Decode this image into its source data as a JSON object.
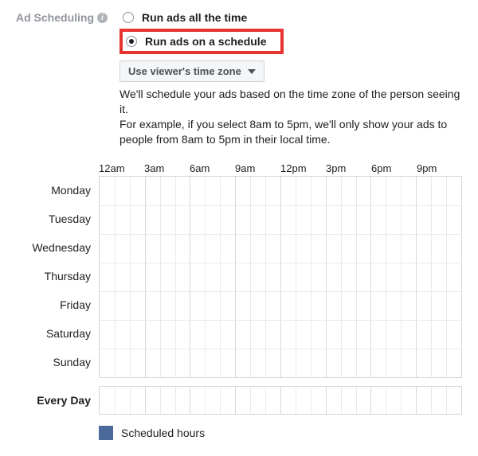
{
  "section": {
    "label": "Ad Scheduling"
  },
  "radios": {
    "all_time": "Run ads all the time",
    "schedule": "Run ads on a schedule",
    "selected": "schedule"
  },
  "timezone": {
    "label": "Use viewer's time zone"
  },
  "description": {
    "line1": "We'll schedule your ads based on the time zone of the person seeing it.",
    "line2": "For example, if you select 8am to 5pm, we'll only show your ads to people from 8am to 5pm in their local time."
  },
  "hours": [
    "12am",
    "3am",
    "6am",
    "9am",
    "12pm",
    "3pm",
    "6pm",
    "9pm"
  ],
  "days": [
    "Monday",
    "Tuesday",
    "Wednesday",
    "Thursday",
    "Friday",
    "Saturday",
    "Sunday"
  ],
  "every_day": "Every Day",
  "legend": {
    "label": "Scheduled hours"
  }
}
